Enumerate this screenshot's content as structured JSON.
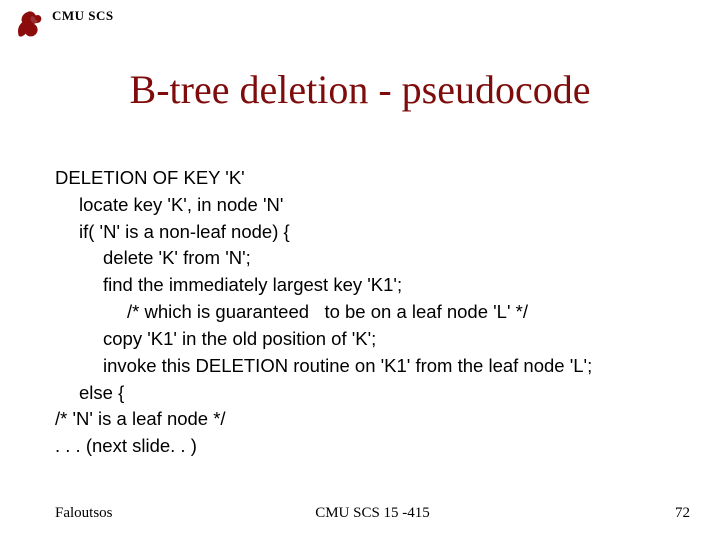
{
  "header": {
    "institution": "CMU SCS"
  },
  "title": "B-tree deletion - pseudocode",
  "code": {
    "l0": "DELETION OF KEY 'K'",
    "l1": "locate key 'K', in node 'N'",
    "l2": "if( 'N' is a non-leaf node) {",
    "l3": "delete 'K' from 'N';",
    "l4": "find the immediately largest key 'K1';",
    "l5": "/* which is guaranteed   to be on a leaf node 'L' */",
    "l6": "copy 'K1' in the old position of 'K';",
    "l7": "invoke this DELETION routine on 'K1' from the leaf node 'L';",
    "l8": "else {",
    "l9": "/* 'N' is a leaf node */",
    "l10": ". . . (next slide. . )"
  },
  "footer": {
    "author": "Faloutsos",
    "course": "CMU SCS 15 -415",
    "page": "72"
  }
}
